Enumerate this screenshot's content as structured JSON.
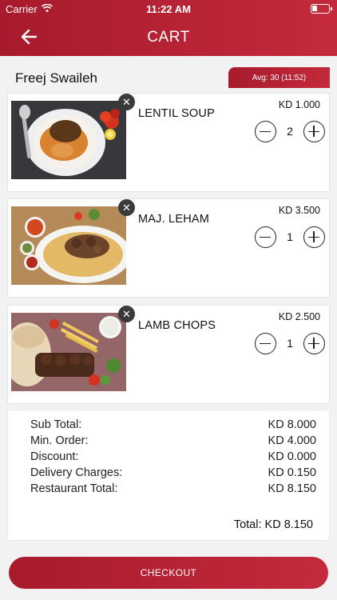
{
  "status_bar": {
    "carrier": "Carrier",
    "time": "11:22 AM"
  },
  "header": {
    "title": "CART",
    "icons": {
      "back": "arrow-left-icon"
    }
  },
  "restaurant": {
    "name": "Freej Swaileh",
    "avg_time": "Avg: 30 (11:52)"
  },
  "items": [
    {
      "name": "LENTIL SOUP",
      "price": "KD 1.000",
      "quantity": "2",
      "image": "lentil-soup-photo"
    },
    {
      "name": "MAJ. LEHAM",
      "price": "KD 3.500",
      "quantity": "1",
      "image": "majboos-laham-photo"
    },
    {
      "name": "LAMB CHOPS",
      "price": "KD 2.500",
      "quantity": "1",
      "image": "lamb-chops-photo"
    }
  ],
  "summary": {
    "subtotal": {
      "label": "Sub Total:",
      "value": "KD 8.000"
    },
    "min_order": {
      "label": "Min. Order:",
      "value": "KD 4.000"
    },
    "discount": {
      "label": "Discount:",
      "value": "KD 0.000"
    },
    "delivery": {
      "label": "Delivery Charges:",
      "value": "KD 0.150"
    },
    "restaurant_total": {
      "label": "Restaurant Total:",
      "value": "KD 8.150"
    },
    "total": "Total: KD 8.150"
  },
  "checkout_label": "CHECKOUT",
  "colors": {
    "primary": "#b01f32",
    "primary_light": "#c42a3c",
    "background": "#f2f2f2"
  }
}
